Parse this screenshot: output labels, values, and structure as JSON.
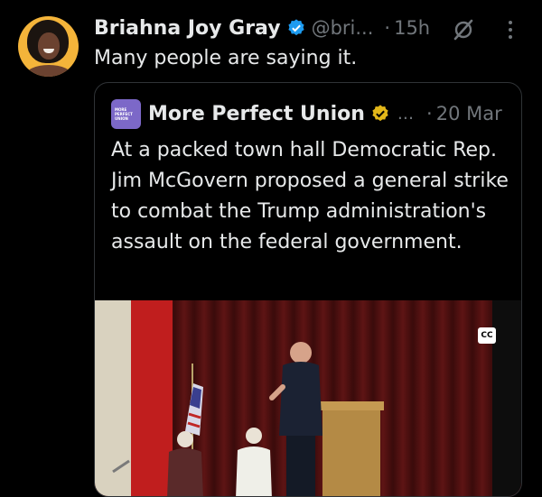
{
  "tweet": {
    "author_name": "Briahna Joy Gray",
    "author_handle": "@bri...",
    "time": "15h",
    "text": "Many people are saying it.",
    "verified": true
  },
  "quoted_tweet": {
    "author_name": "More Perfect Union",
    "logo_text": [
      "MORE",
      "PERFECT",
      "UNION"
    ],
    "ellipsis": "...",
    "date": "20 Mar",
    "text": "At a packed town hall Democratic Rep. Jim McGovern proposed a general strike to combat the Trump administration's assault on the federal government.",
    "media": {
      "cc_label": "CC"
    }
  },
  "ui": {
    "dot": "·"
  },
  "colors": {
    "background": "#000000",
    "text": "#e7e9ea",
    "muted": "#71767b",
    "verified_blue": "#1d9bf0",
    "verified_gold": "#e2b719",
    "border": "#2f3336"
  },
  "icons": [
    "verified-badge-icon",
    "grok-icon",
    "more-options-icon",
    "gold-verified-badge-icon",
    "closed-captions-icon"
  ]
}
